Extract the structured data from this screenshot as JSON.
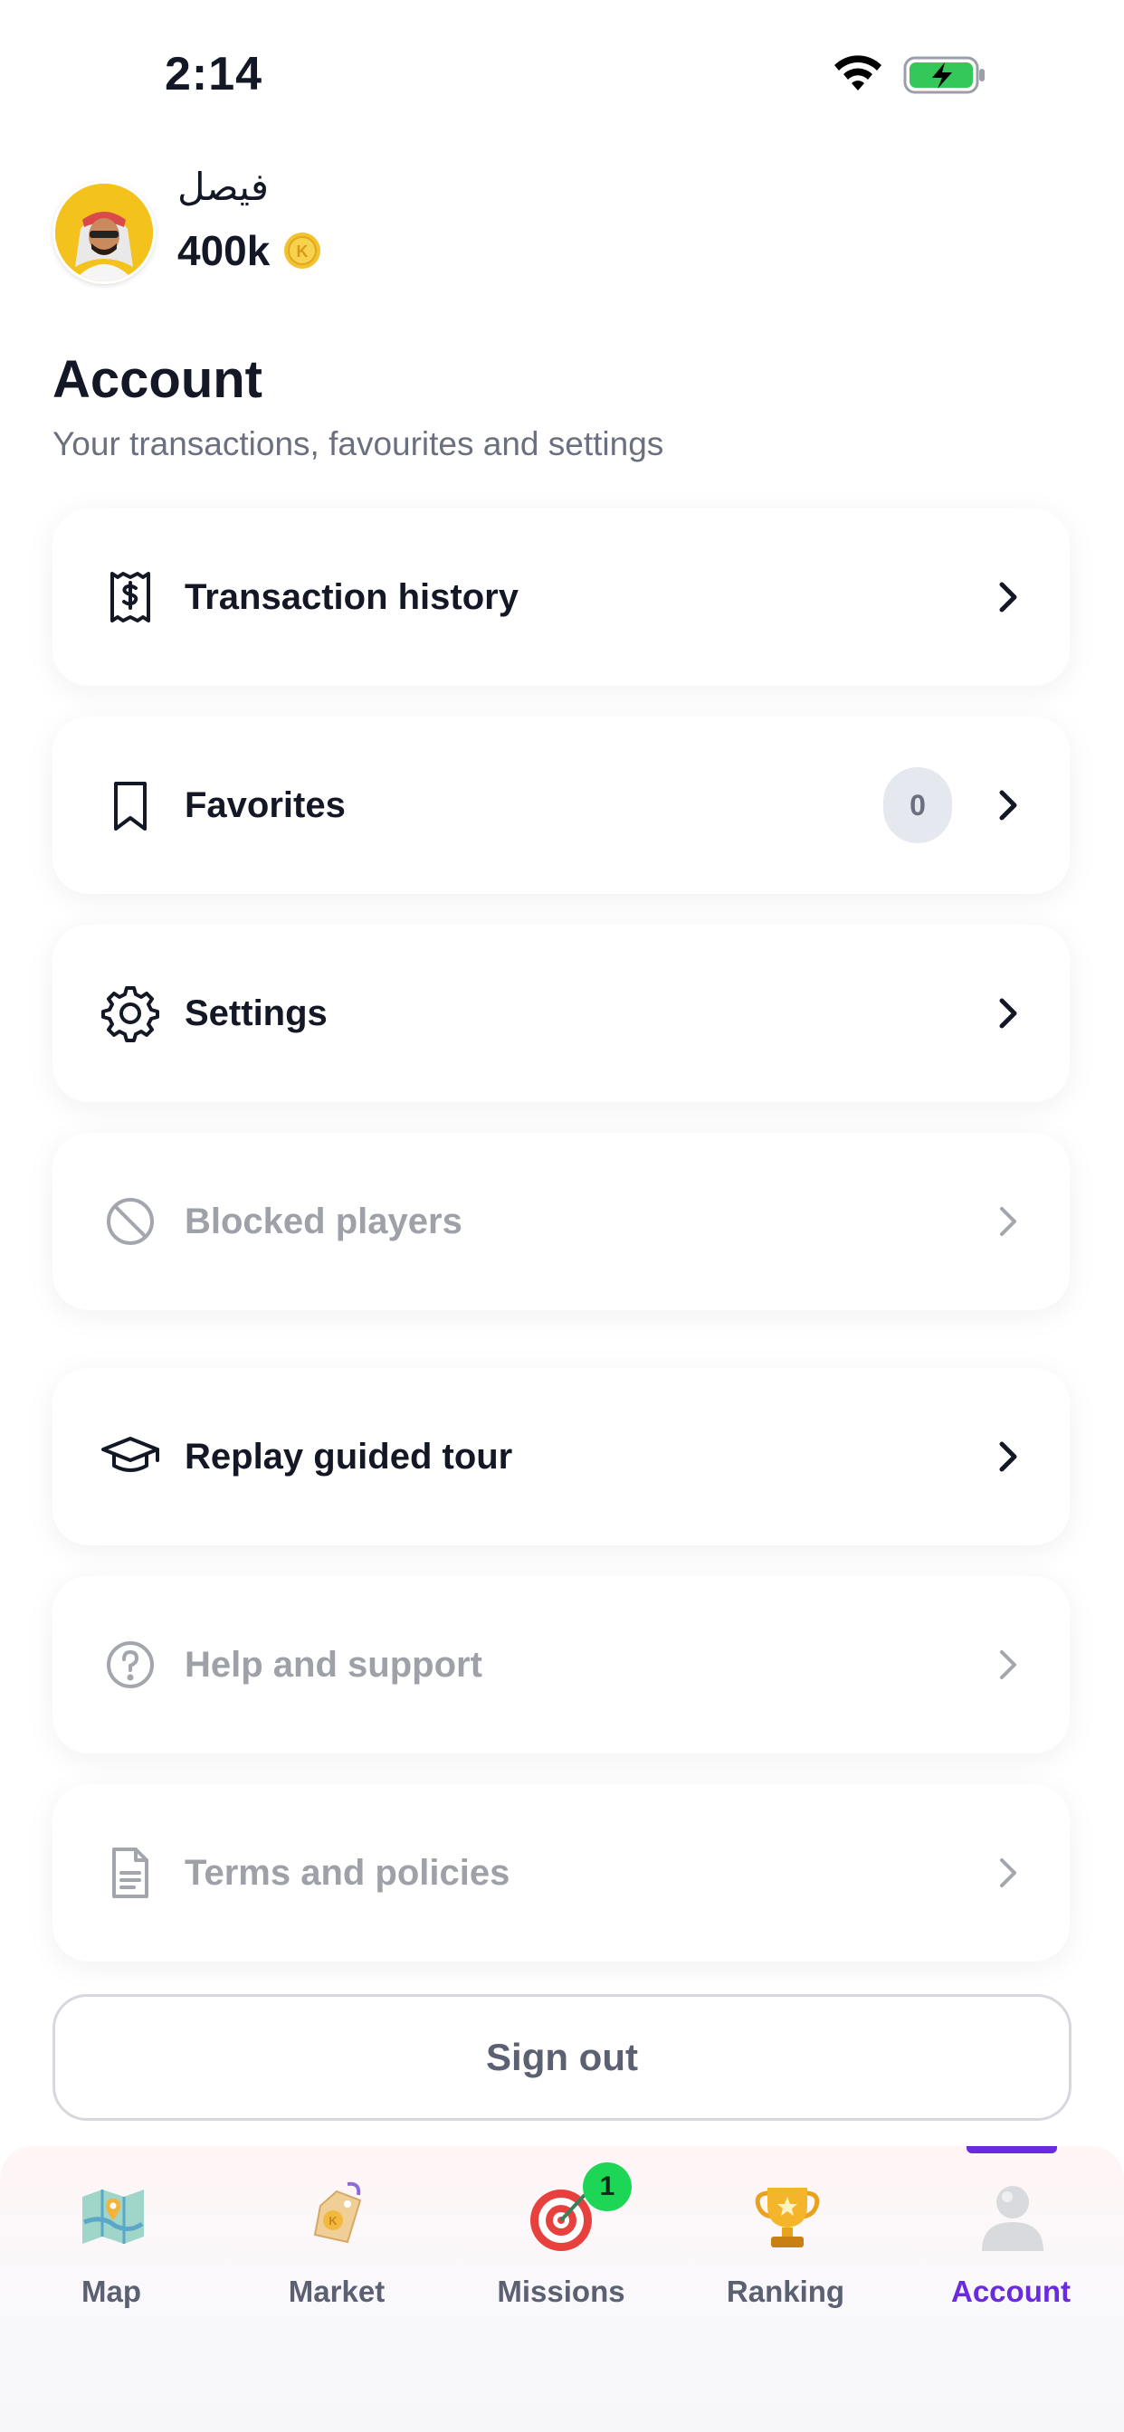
{
  "status_bar": {
    "time": "2:14"
  },
  "profile": {
    "username": "فیصل",
    "balance": "400k"
  },
  "header": {
    "title": "Account",
    "subtitle": "Your transactions, favourites and settings"
  },
  "menu": [
    {
      "label": "Transaction history",
      "icon": "receipt-dollar-icon",
      "enabled": true
    },
    {
      "label": "Favorites",
      "icon": "bookmark-icon",
      "enabled": true,
      "badge": "0"
    },
    {
      "label": "Settings",
      "icon": "gear-icon",
      "enabled": true
    },
    {
      "label": "Blocked players",
      "icon": "blocked-icon",
      "enabled": false
    },
    {
      "label": "Replay guided tour",
      "icon": "graduation-cap-icon",
      "enabled": true
    },
    {
      "label": "Help and support",
      "icon": "question-circle-icon",
      "enabled": false
    },
    {
      "label": "Terms and policies",
      "icon": "document-icon",
      "enabled": false
    }
  ],
  "signout_label": "Sign out",
  "nav": {
    "items": [
      {
        "label": "Map",
        "icon": "map-icon"
      },
      {
        "label": "Market",
        "icon": "price-tag-icon"
      },
      {
        "label": "Missions",
        "icon": "target-icon",
        "badge": "1"
      },
      {
        "label": "Ranking",
        "icon": "trophy-icon"
      },
      {
        "label": "Account",
        "icon": "user-icon",
        "active": true
      }
    ]
  },
  "colors": {
    "accent": "#6a2be0",
    "badge_green": "#1ed655",
    "coin": "#f2c230"
  }
}
